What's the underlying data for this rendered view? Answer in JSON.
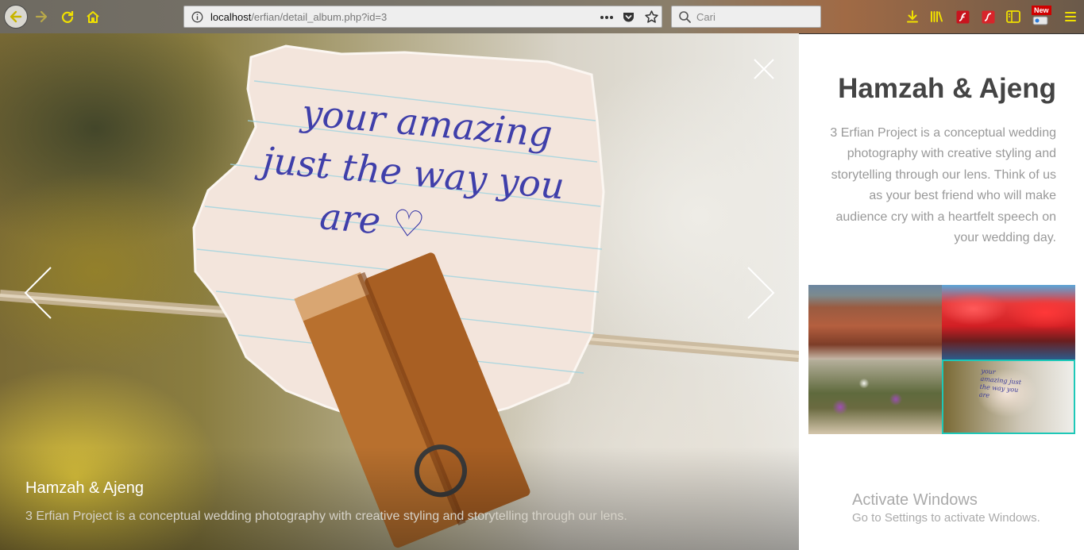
{
  "browser": {
    "url_host": "localhost",
    "url_path": "/erfian/detail_album.php?id=3",
    "search_placeholder": "Cari",
    "new_badge": "New"
  },
  "lightbox": {
    "note_line1": "your amazing",
    "note_line2": "just the way you",
    "note_line3": "are",
    "caption_title": "Hamzah & Ajeng",
    "caption_desc": "3 Erfian Project is a conceptual wedding photography with creative styling and storytelling through our lens."
  },
  "album": {
    "title": "Hamzah & Ajeng",
    "description": "3 Erfian Project is a conceptual wedding photography with creative styling and storytelling through our lens. Think of us as your best friend who will make audience cry with a heartfelt speech on your wedding day.",
    "thumbnail_text": "your amazing just the way you are"
  },
  "watermark": {
    "title": "Activate Windows",
    "subtitle": "Go to Settings to activate Windows."
  },
  "colors": {
    "accent": "#1ec8b8",
    "toolbar_icons": "#f0e000"
  }
}
